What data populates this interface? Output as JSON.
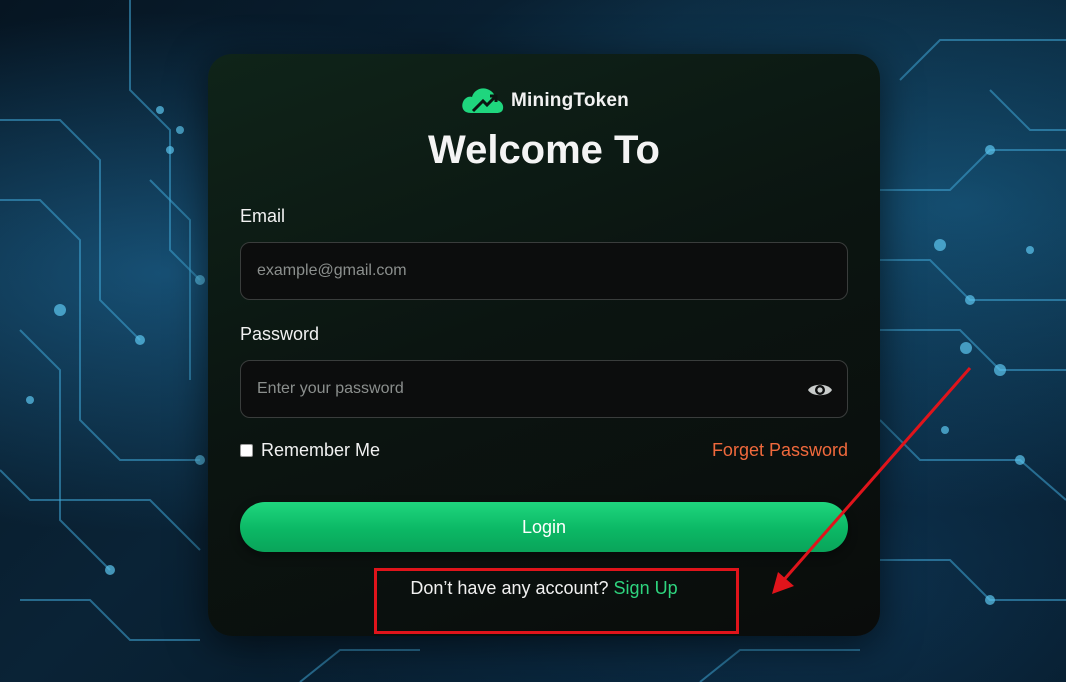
{
  "brand": {
    "name": "MiningToken",
    "logo_icon": "cloud-arrow-icon",
    "accent": "#1fd67e"
  },
  "title": "Welcome To",
  "email": {
    "label": "Email",
    "placeholder": "example@gmail.com",
    "value": ""
  },
  "password": {
    "label": "Password",
    "placeholder": "Enter your password",
    "value": "",
    "toggle_icon": "eye-icon"
  },
  "remember": {
    "label": "Remember Me",
    "checked": false
  },
  "forgot": {
    "label": "Forget Password",
    "color": "#f0693c"
  },
  "login": {
    "label": "Login"
  },
  "signup": {
    "prompt": "Don’t have any account?",
    "link": "Sign Up",
    "link_color": "#2ed47e"
  },
  "annotation": {
    "color": "#e0141b"
  }
}
